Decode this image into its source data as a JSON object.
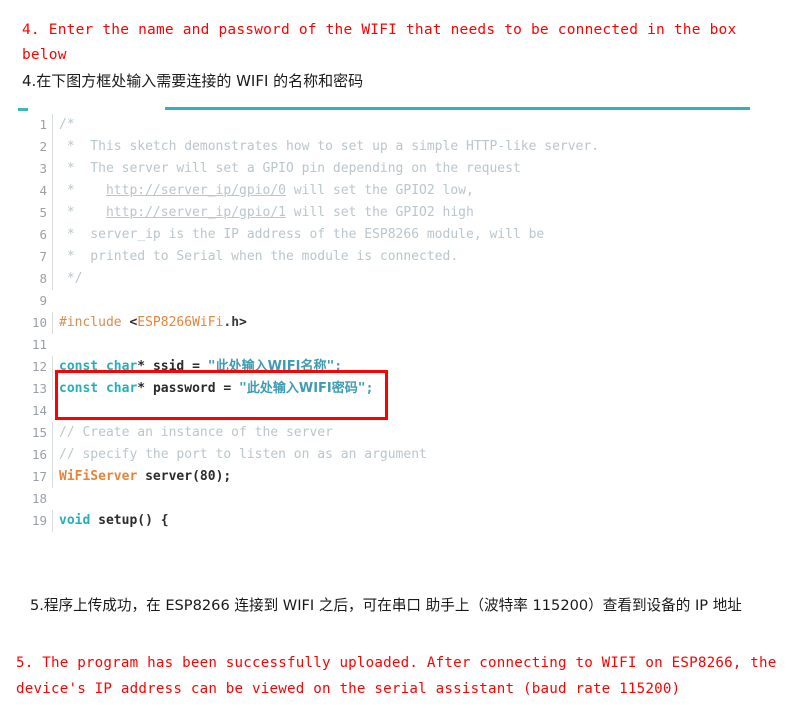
{
  "instructions": {
    "top_en": "4. Enter the name and password of the WIFI that needs to be connected in the box below",
    "top_cn": "4.在下图方框处输入需要连接的 WIFI 的名称和密码",
    "bottom_cn": "5.程序上传成功，在 ESP8266 连接到 WIFI 之后，可在串口 助手上（波特率 115200）查看到设备的 IP 地址",
    "bottom_en": "5. The program has been successfully uploaded. After connecting to WIFI on ESP8266, the device's IP address can be viewed on the serial assistant (baud rate 115200)"
  },
  "colors": {
    "instruction_red": "#ff0000",
    "rule_teal": "#2fb3b8",
    "highlight_border": "#ff0000",
    "comment_gray": "#b9c6cc",
    "keyword_teal": "#24b0b8",
    "type_orange": "#e8833a",
    "string_blue": "#3e9bb5"
  },
  "code": {
    "language": "arduino-cpp",
    "lines": [
      {
        "n": "1",
        "segments": [
          {
            "t": "/*",
            "c": "c-comment"
          }
        ]
      },
      {
        "n": "2",
        "segments": [
          {
            "t": " *  This sketch demonstrates how to set up a simple HTTP-like server.",
            "c": "c-comment"
          }
        ]
      },
      {
        "n": "3",
        "segments": [
          {
            "t": " *  The server will set a GPIO pin depending on the request",
            "c": "c-comment"
          }
        ]
      },
      {
        "n": "4",
        "segments": [
          {
            "t": " *    ",
            "c": "c-comment"
          },
          {
            "t": "http://server_ip/gpio/0",
            "c": "c-link"
          },
          {
            "t": " will set the GPIO2 low,",
            "c": "c-comment"
          }
        ]
      },
      {
        "n": "5",
        "segments": [
          {
            "t": " *    ",
            "c": "c-comment"
          },
          {
            "t": "http://server_ip/gpio/1",
            "c": "c-link"
          },
          {
            "t": " will set the GPIO2 high",
            "c": "c-comment"
          }
        ]
      },
      {
        "n": "6",
        "segments": [
          {
            "t": " *  server_ip is the IP address of the ESP8266 module, will be",
            "c": "c-comment"
          }
        ]
      },
      {
        "n": "7",
        "segments": [
          {
            "t": " *  printed to Serial when the module is connected.",
            "c": "c-comment"
          }
        ]
      },
      {
        "n": "8",
        "segments": [
          {
            "t": " */",
            "c": "c-comment"
          }
        ]
      },
      {
        "n": "9",
        "segments": [
          {
            "t": "",
            "c": "c-comment"
          }
        ]
      },
      {
        "n": "10",
        "segments": [
          {
            "t": "#include ",
            "c": "c-pre"
          },
          {
            "t": "<",
            "c": "c-punc"
          },
          {
            "t": "ESP8266WiFi",
            "c": "c-inc"
          },
          {
            "t": ".h",
            "c": "c-incdot"
          },
          {
            "t": ">",
            "c": "c-punc"
          }
        ]
      },
      {
        "n": "11",
        "segments": [
          {
            "t": "",
            "c": "c-comment"
          }
        ]
      },
      {
        "n": "12",
        "segments": [
          {
            "t": "const char",
            "c": "c-kw"
          },
          {
            "t": "* ",
            "c": "c-punc"
          },
          {
            "t": "ssid",
            "c": "c-ident"
          },
          {
            "t": " = ",
            "c": "c-punc"
          },
          {
            "t": "\"",
            "c": "c-str"
          },
          {
            "t": "此处输入WIFI名称",
            "c": "c-cn"
          },
          {
            "t": "\";",
            "c": "c-str"
          }
        ]
      },
      {
        "n": "13",
        "segments": [
          {
            "t": "const char",
            "c": "c-kw"
          },
          {
            "t": "* ",
            "c": "c-punc"
          },
          {
            "t": "password",
            "c": "c-ident"
          },
          {
            "t": " = ",
            "c": "c-punc"
          },
          {
            "t": "\"",
            "c": "c-str"
          },
          {
            "t": "此处输入WIFI密码",
            "c": "c-cn"
          },
          {
            "t": "\";",
            "c": "c-str"
          }
        ]
      },
      {
        "n": "14",
        "segments": [
          {
            "t": "",
            "c": "c-comment"
          }
        ]
      },
      {
        "n": "15",
        "segments": [
          {
            "t": "// Create an instance of the server",
            "c": "c-comment"
          }
        ]
      },
      {
        "n": "16",
        "segments": [
          {
            "t": "// specify the port to listen on as an argument",
            "c": "c-comment"
          }
        ]
      },
      {
        "n": "17",
        "segments": [
          {
            "t": "WiFiServer",
            "c": "c-type"
          },
          {
            "t": " ",
            "c": "c-punc"
          },
          {
            "t": "server",
            "c": "c-ident"
          },
          {
            "t": "(",
            "c": "c-punc"
          },
          {
            "t": "80",
            "c": "c-num"
          },
          {
            "t": ");",
            "c": "c-punc"
          }
        ]
      },
      {
        "n": "18",
        "segments": [
          {
            "t": "",
            "c": "c-comment"
          }
        ]
      },
      {
        "n": "19",
        "segments": [
          {
            "t": "void",
            "c": "c-kw"
          },
          {
            "t": " ",
            "c": "c-punc"
          },
          {
            "t": "setup",
            "c": "c-ident"
          },
          {
            "t": "() {",
            "c": "c-punc"
          }
        ]
      }
    ]
  }
}
